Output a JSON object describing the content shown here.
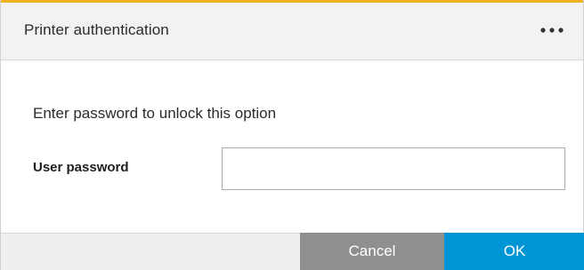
{
  "dialog": {
    "title": "Printer authentication",
    "more_icon": "more-horizontal-icon",
    "prompt": "Enter password to unlock this option",
    "password_label": "User password",
    "password_value": "",
    "password_placeholder": "",
    "cancel_label": "Cancel",
    "ok_label": "OK"
  },
  "colors": {
    "accent": "#f0b020",
    "ok_button": "#0096d6",
    "cancel_button": "#8f8f8f",
    "header_bg": "#f2f2f2"
  }
}
